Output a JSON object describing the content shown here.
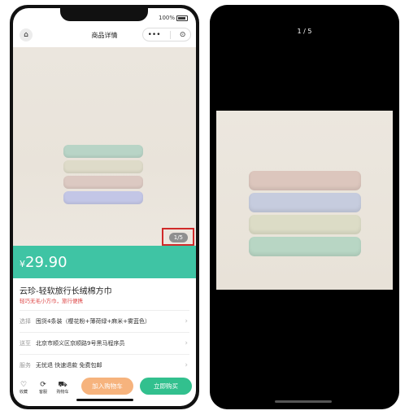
{
  "left_phone": {
    "status": {
      "battery_text": "100%"
    },
    "navbar": {
      "title": "商品详情",
      "menu_glyph": "•••",
      "close_glyph": "⊙",
      "home_glyph": "⌂"
    },
    "gallery": {
      "counter": "1/5"
    },
    "price": {
      "symbol": "¥",
      "value": "29.90"
    },
    "product": {
      "title": "云珍-轻软旅行长绒棉方巾",
      "subtitle": "轻巧无毛小方巾，旅行便携"
    },
    "rows": [
      {
        "label": "选择",
        "value": "囤货4条装（樱花粉+薄荷绿+麻米+雾蓝色）"
      },
      {
        "label": "送至",
        "value": "北京市顺义区京顺路9号黑马程序员"
      },
      {
        "label": "服务",
        "value": "无忧退 快速退款 免费包邮"
      }
    ],
    "bottom_bar": {
      "favorite": {
        "label": "收藏",
        "icon": "heart-icon"
      },
      "service": {
        "label": "客服",
        "icon": "headset-icon"
      },
      "cart": {
        "label": "购物车",
        "icon": "cart-icon"
      },
      "add_to_cart": "加入购物车",
      "buy_now": "立即购买"
    }
  },
  "right_phone": {
    "counter": "1 / 5"
  },
  "colors": {
    "accent_green": "#3fc4a4",
    "buy_green": "#32c08e",
    "cart_orange": "#f6b37d",
    "highlight_red": "#d02a2a"
  }
}
